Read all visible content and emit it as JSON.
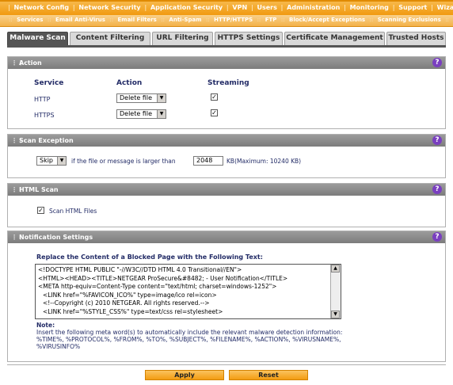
{
  "topnav": {
    "items": [
      "Network Config",
      "Network Security",
      "Application Security",
      "VPN",
      "Users",
      "Administration",
      "Monitoring",
      "Support",
      "Wizards"
    ],
    "active": "Application Security"
  },
  "subnav": {
    "items": [
      "Services",
      "Email Anti-Virus",
      "Email Filters",
      "Anti-Spam",
      "HTTP/HTTPS",
      "FTP",
      "Block/Accept Exceptions",
      "Scanning Exclusions"
    ],
    "active": "HTTP/HTTPS"
  },
  "tabs": [
    "Malware Scan",
    "Content Filtering",
    "URL Filtering",
    "HTTPS Settings",
    "Certificate Management",
    "Trusted Hosts"
  ],
  "active_tab": "Malware Scan",
  "action": {
    "title": "Action",
    "col_service": "Service",
    "col_action": "Action",
    "col_streaming": "Streaming",
    "rows": [
      {
        "service": "HTTP",
        "action": "Delete file",
        "streaming": true
      },
      {
        "service": "HTTPS",
        "action": "Delete file",
        "streaming": true
      }
    ]
  },
  "scan_exception": {
    "title": "Scan Exception",
    "select": "Skip",
    "text": "if the file or message is larger than",
    "value": "2048",
    "suffix": "KB(Maximum: 10240 KB)"
  },
  "html_scan": {
    "title": "HTML Scan",
    "checkbox_label": "Scan HTML Files",
    "checked": true
  },
  "notification": {
    "title": "Notification Settings",
    "heading": "Replace the Content of a Blocked Page with the Following Text:",
    "lines": [
      "<!DOCTYPE HTML PUBLIC \"-//W3C//DTD HTML 4.0 Transitional//EN\">",
      "<HTML><HEAD><TITLE>NETGEAR ProSecure&#8482; - User Notification</TITLE>",
      "<META http-equiv=Content-Type content=\"text/html; charset=windows-1252\">",
      "  <LINK href=\"%FAVICON_ICO%\" type=image/ico rel=icon>",
      "  <!--Copyright (c) 2010 NETGEAR. All rights reserved.-->",
      "  <LINK href=\"%STYLE_CSS%\" type=text/css rel=stylesheet>"
    ],
    "note_label": "Note:",
    "note_line1": "Insert the following meta word(s) to automatically include the relevant malware detection information:",
    "note_line2": "%TIME%, %PROTOCOL%, %FROM%, %TO%, %SUBJECT%, %FILENAME%, %ACTION%, %VIRUSNAME%,",
    "note_line3": "%VIRUSINFO%"
  },
  "buttons": {
    "apply": "Apply",
    "reset": "Reset"
  },
  "help_glyph": "?",
  "colors": {
    "accent": "#f39c12",
    "panel_head": "#8a8a8a",
    "label": "#222b66",
    "help": "#7a3fc0"
  }
}
